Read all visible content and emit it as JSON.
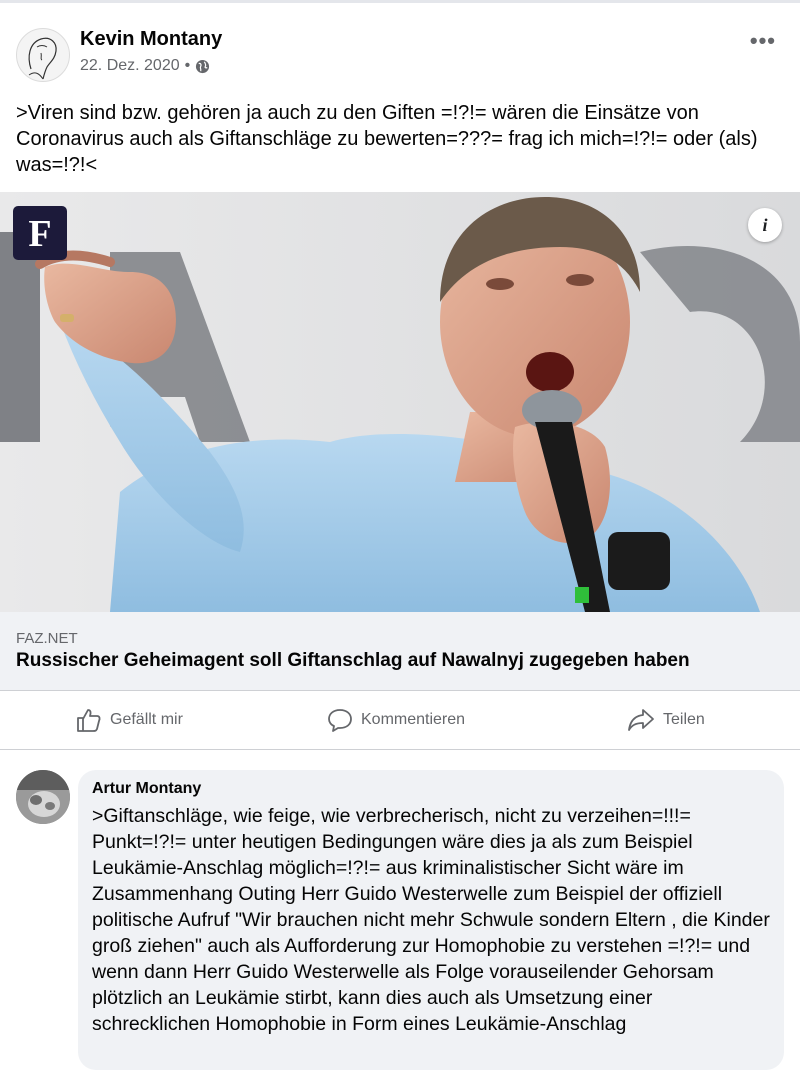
{
  "post": {
    "author": "Kevin Montany",
    "date": "22. Dez. 2020",
    "separator": "•",
    "privacy_icon": "globe-icon",
    "more_label": "•••",
    "text": ">Viren sind bzw. gehören ja auch zu den Giften =!?!= wären die Einsätze von Coronavirus auch als  Giftanschläge zu bewerten=???= frag ich mich=!?!= oder (als) was=!?!<"
  },
  "link_preview": {
    "publisher_logo_letter": "F",
    "info_label": "i",
    "domain": "FAZ.NET",
    "title": "Russischer Geheimagent soll Giftanschlag auf Nawalnyj zugegeben haben"
  },
  "actions": {
    "like": "Gefällt mir",
    "comment": "Kommentieren",
    "share": "Teilen"
  },
  "comment": {
    "author": "Artur Montany",
    "text": ">Giftanschläge, wie feige, wie verbrecherisch, nicht zu verzeihen=!!!= Punkt=!?!= unter heutigen Bedingungen wäre dies ja als zum Beispiel Leukämie-Anschlag möglich=!?!= aus kriminalistischer Sicht wäre im Zusammenhang Outing Herr Guido Westerwelle zum Beispiel der offiziell politische Aufruf \"Wir brauchen nicht mehr Schwule sondern Eltern , die Kinder groß ziehen\" auch als Aufforderung zur Homophobie zu verstehen =!?!= und wenn dann  Herr Guido Westerwelle als Folge vorauseilender Gehorsam plötzlich an Leukämie stirbt, kann dies auch als Umsetzung einer schrecklichen Homophobie in Form eines Leukämie-Anschlag"
  },
  "colors": {
    "secondary_text": "#65676b",
    "card_background": "#f0f2f5",
    "faz_logo": "#1c1a3a",
    "shirt": "#a9cde9"
  }
}
